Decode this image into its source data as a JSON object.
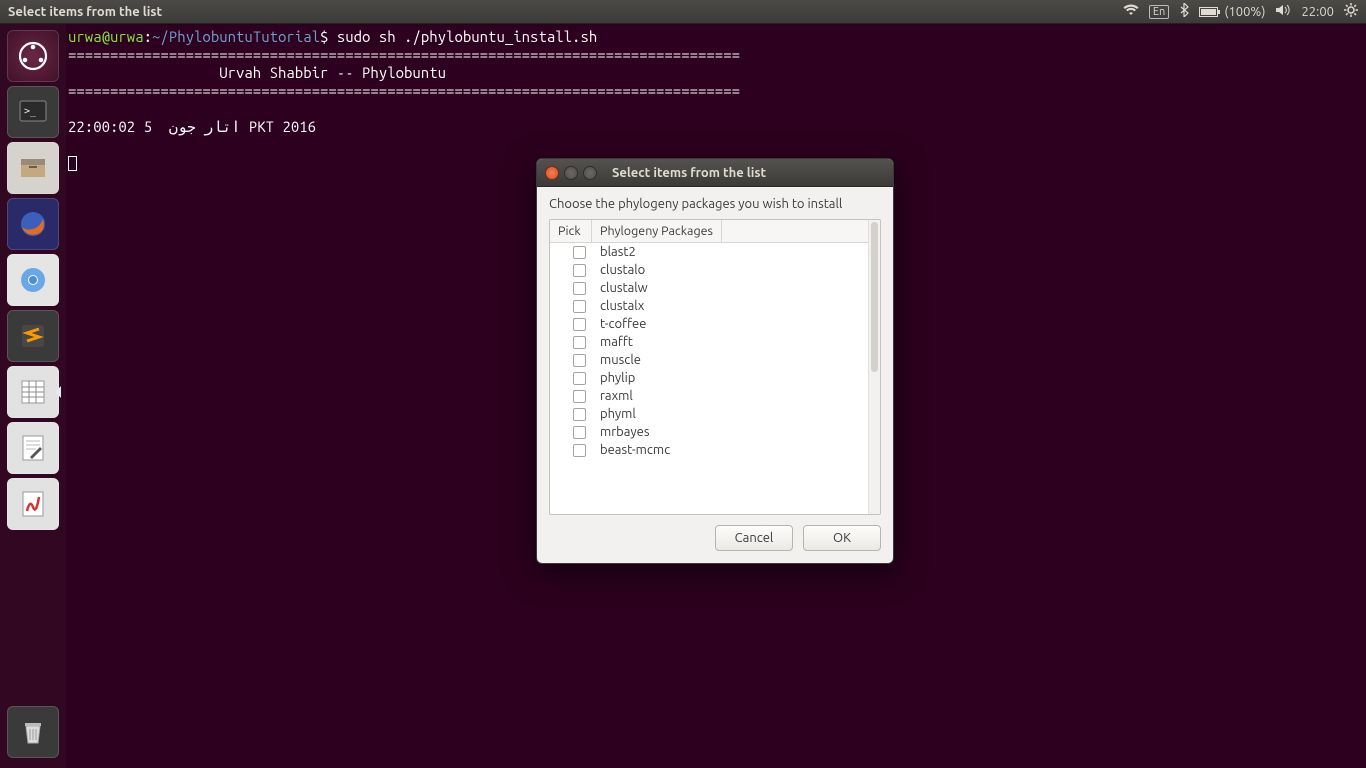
{
  "menubar": {
    "title": "Select items from the list",
    "language": "En",
    "battery": "(100%)",
    "clock": "22:00"
  },
  "terminal": {
    "user": "urwa@urwa",
    "path": "~/PhylobuntuTutorial",
    "command": "sudo sh ./phylobuntu_install.sh",
    "sep": "================================================================================",
    "banner": "                  Urvah Shabbir -- Phylobuntu",
    "dateline": "اتار جون  5 22:00:02 PKT 2016"
  },
  "dialog": {
    "title": "Select items from the list",
    "instruction": "Choose the phylogeny packages you wish to install",
    "col_pick": "Pick",
    "col_pkg": "Phylogeny Packages",
    "packages": [
      "blast2",
      "clustalo",
      "clustalw",
      "clustalx",
      "t-coffee",
      "mafft",
      "muscle",
      "phylip",
      "raxml",
      "phyml",
      "mrbayes",
      "beast-mcmc"
    ],
    "cancel": "Cancel",
    "ok": "OK"
  }
}
